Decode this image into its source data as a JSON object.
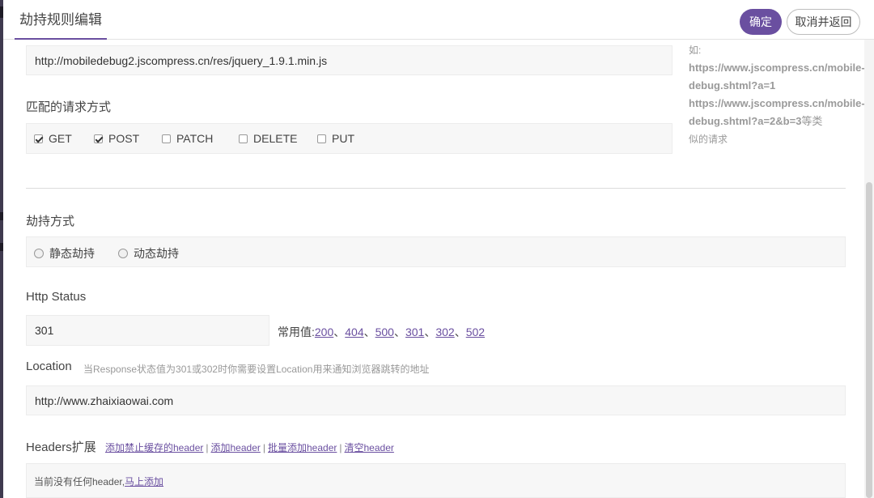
{
  "header": {
    "title": "劫持规则编辑",
    "confirm_label": "确定",
    "cancel_label": "取消并返回"
  },
  "url_field": {
    "value": "http://mobiledebug2.jscompress.cn/res/jquery_1.9.1.min.js"
  },
  "side_example": {
    "prefix": "如:",
    "line1": "https://www.jscompress.cn/mobile-",
    "line2": "debug.shtml?a=1",
    "line3": "https://www.jscompress.cn/mobile-",
    "line4": "debug.shtml?a=2&b=3",
    "line4_suffix": "等类",
    "line5": "似的请求"
  },
  "methods": {
    "label": "匹配的请求方式",
    "items": [
      {
        "label": "GET",
        "checked": true
      },
      {
        "label": "POST",
        "checked": true
      },
      {
        "label": "PATCH",
        "checked": false
      },
      {
        "label": "DELETE",
        "checked": false
      },
      {
        "label": "PUT",
        "checked": false
      }
    ]
  },
  "hijack_mode": {
    "label": "劫持方式",
    "options": [
      {
        "label": "静态劫持",
        "selected": false
      },
      {
        "label": "动态劫持",
        "selected": false
      }
    ]
  },
  "http_status": {
    "label": "Http Status",
    "value": "301",
    "common_prefix": "常用值:",
    "common_values": [
      "200",
      "404",
      "500",
      "301",
      "302",
      "502"
    ],
    "separator": "、"
  },
  "location": {
    "label": "Location",
    "hint": "当Response状态值为301或302时你需要设置Location用来通知浏览器跳转的地址",
    "value": "http://www.zhaixiaowai.com"
  },
  "headers_ext": {
    "label": "Headers扩展",
    "links": [
      "添加禁止缓存的header",
      "添加header",
      "批量添加header",
      "清空header"
    ],
    "separator": "|",
    "empty_text": "当前没有任何header,",
    "empty_link": "马上添加"
  },
  "colors": {
    "accent": "#6a4fa0"
  }
}
